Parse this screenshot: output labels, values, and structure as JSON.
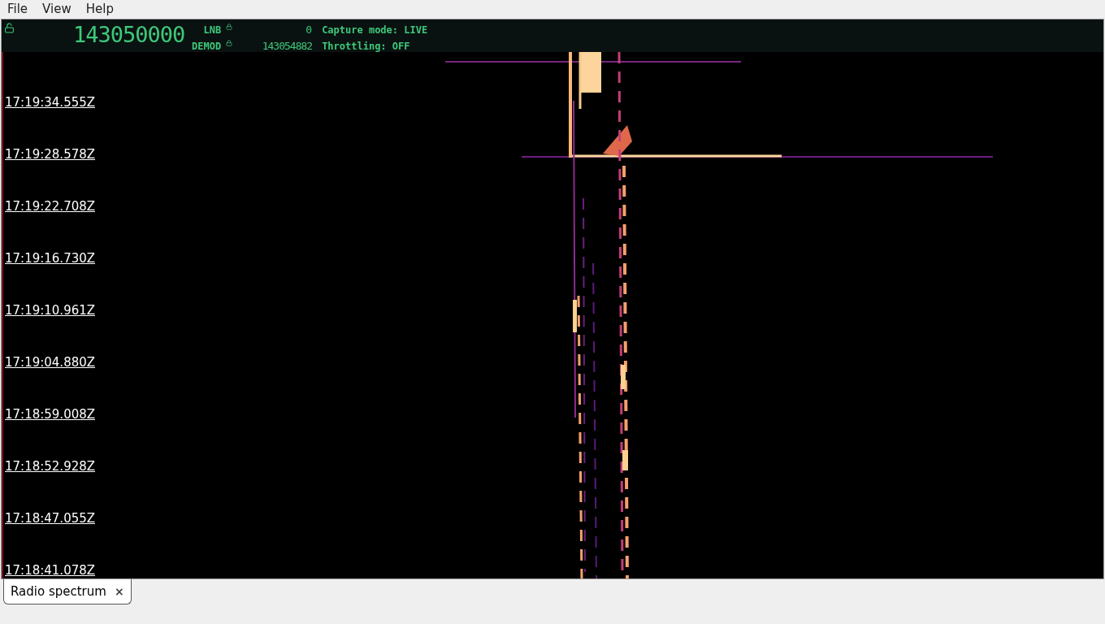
{
  "menu": [
    "File",
    "View",
    "Help"
  ],
  "header": {
    "frequency": "143050000",
    "lnb_label": "LNB",
    "lnb_value": "0",
    "demod_label": "DEMOD",
    "demod_value": "143054882",
    "capture_mode": "Capture mode: LIVE",
    "throttling": "Throttling: OFF"
  },
  "timestamps": [
    "17:19:34.555Z",
    "17:19:28.578Z",
    "17:19:22.708Z",
    "17:19:16.730Z",
    "17:19:10.961Z",
    "17:19:04.880Z",
    "17:18:59.008Z",
    "17:18:52.928Z",
    "17:18:47.055Z",
    "17:18:41.078Z"
  ],
  "tabs": [
    {
      "label": "Radio spectrum",
      "selected": true,
      "close": "×"
    }
  ]
}
